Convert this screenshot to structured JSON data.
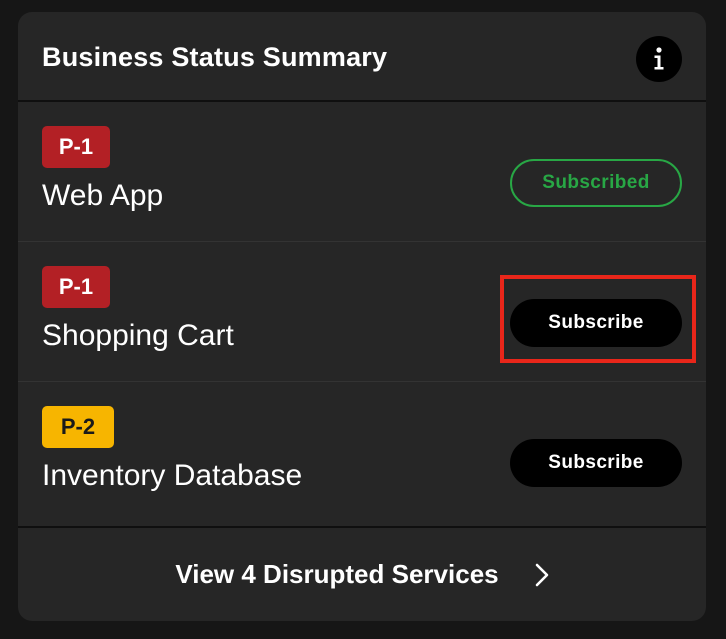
{
  "header": {
    "title": "Business Status Summary",
    "info_icon": "info-icon"
  },
  "services": [
    {
      "priority": "P-1",
      "name": "Web App",
      "action_label": "Subscribed",
      "subscribed": true,
      "priority_color": "#b32025"
    },
    {
      "priority": "P-1",
      "name": "Shopping Cart",
      "action_label": "Subscribe",
      "subscribed": false,
      "priority_color": "#b32025"
    },
    {
      "priority": "P-2",
      "name": "Inventory Database",
      "action_label": "Subscribe",
      "subscribed": false,
      "priority_color": "#f7b500"
    }
  ],
  "footer": {
    "label": "View 4 Disrupted Services",
    "icon": "chevron-right-icon"
  },
  "colors": {
    "accent_green": "#28a745",
    "highlight_red": "#e8261a",
    "card_bg": "#262626"
  }
}
